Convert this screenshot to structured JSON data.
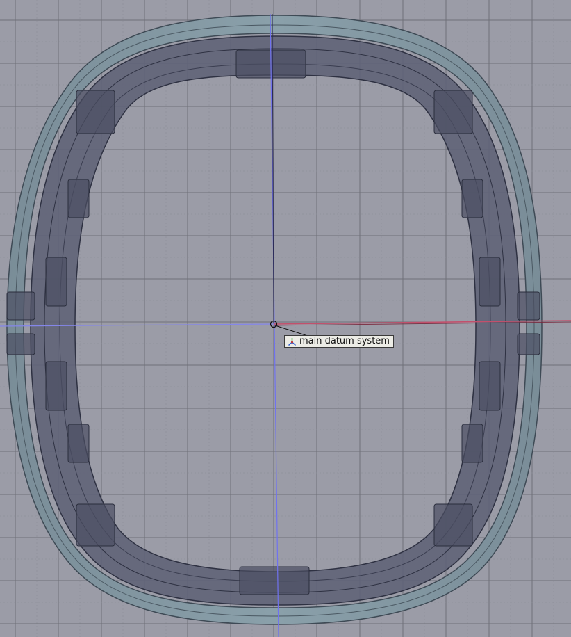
{
  "viewport": {
    "background": "#9b9ca7",
    "grid_color": "#6f7079",
    "grid_minor_color": "#8f909a"
  },
  "part": {
    "outer_rim_color": "#7f929c",
    "outer_rim_edge_color": "#3e4a55",
    "body_color": "#5e6276",
    "body_dark_color": "#4b4e62",
    "edge_color": "#2e3142"
  },
  "datum": {
    "label": "main datum system",
    "icon": "datum-axes-icon",
    "axis_vertical_color": "#6e6ff0",
    "axis_horizontal_left_color": "#7d7fe6",
    "axis_horizontal_right_color": "#c0506a"
  }
}
